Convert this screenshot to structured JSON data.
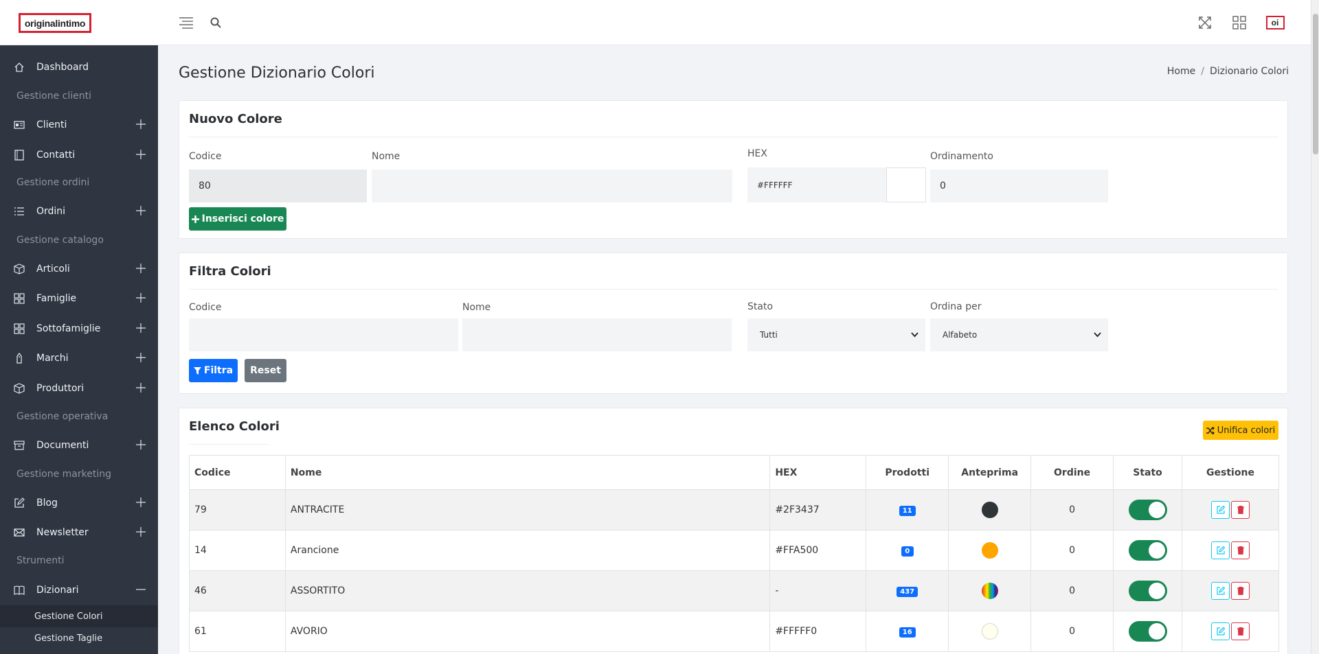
{
  "app": {
    "logo_text": "originalintimo",
    "user_initials": "oi"
  },
  "sidebar": {
    "dashboard": "Dashboard",
    "sections": {
      "clienti": "Gestione clienti",
      "ordini": "Gestione ordini",
      "catalogo": "Gestione catalogo",
      "operativa": "Gestione operativa",
      "marketing": "Gestione marketing",
      "strumenti": "Strumenti"
    },
    "items": {
      "clienti": "Clienti",
      "contatti": "Contatti",
      "ordini": "Ordini",
      "articoli": "Articoli",
      "famiglie": "Famiglie",
      "sottofamiglie": "Sottofamiglie",
      "marchi": "Marchi",
      "produttori": "Produttori",
      "documenti": "Documenti",
      "blog": "Blog",
      "newsletter": "Newsletter",
      "dizionari": "Dizionari"
    },
    "sub": {
      "colori": "Gestione Colori",
      "taglie": "Gestione Taglie"
    }
  },
  "page": {
    "title": "Gestione Dizionario Colori",
    "breadcrumb": {
      "home": "Home",
      "separator": "/",
      "current": "Dizionario Colori"
    }
  },
  "new_color": {
    "title": "Nuovo Colore",
    "labels": {
      "codice": "Codice",
      "nome": "Nome",
      "hex": "HEX",
      "ordinamento": "Ordinamento"
    },
    "values": {
      "codice": "80",
      "nome": "",
      "hex": "#FFFFFF",
      "ordinamento": "0"
    },
    "submit": "Inserisci colore"
  },
  "filter": {
    "title": "Filtra Colori",
    "labels": {
      "codice": "Codice",
      "nome": "Nome",
      "stato": "Stato",
      "ordina": "Ordina per"
    },
    "stato_selected": "Tutti",
    "ordina_selected": "Alfabeto",
    "filter_btn": "Filtra",
    "reset_btn": "Reset"
  },
  "list": {
    "title": "Elenco Colori",
    "merge_btn": "Unifica colori",
    "columns": {
      "codice": "Codice",
      "nome": "Nome",
      "hex": "HEX",
      "prodotti": "Prodotti",
      "anteprima": "Anteprima",
      "ordine": "Ordine",
      "stato": "Stato",
      "gestione": "Gestione"
    },
    "rows": [
      {
        "codice": "79",
        "nome": "ANTRACITE",
        "hex": "#2F3437",
        "prodotti": "11",
        "ordine": "0",
        "swatch": "#2F3437"
      },
      {
        "codice": "14",
        "nome": "Arancione",
        "hex": "#FFA500",
        "prodotti": "0",
        "ordine": "0",
        "swatch": "#FFA500"
      },
      {
        "codice": "46",
        "nome": "ASSORTITO",
        "hex": "-",
        "prodotti": "437",
        "ordine": "0",
        "swatch": "rainbow"
      },
      {
        "codice": "61",
        "nome": "AVORIO",
        "hex": "#FFFFF0",
        "prodotti": "16",
        "ordine": "0",
        "swatch": "#FFFFF0"
      }
    ]
  },
  "colors": {
    "brand": "#d4202f",
    "sidebar": "#2f3541",
    "success": "#198754",
    "primary": "#0d6efd",
    "warning": "#ffc107"
  }
}
